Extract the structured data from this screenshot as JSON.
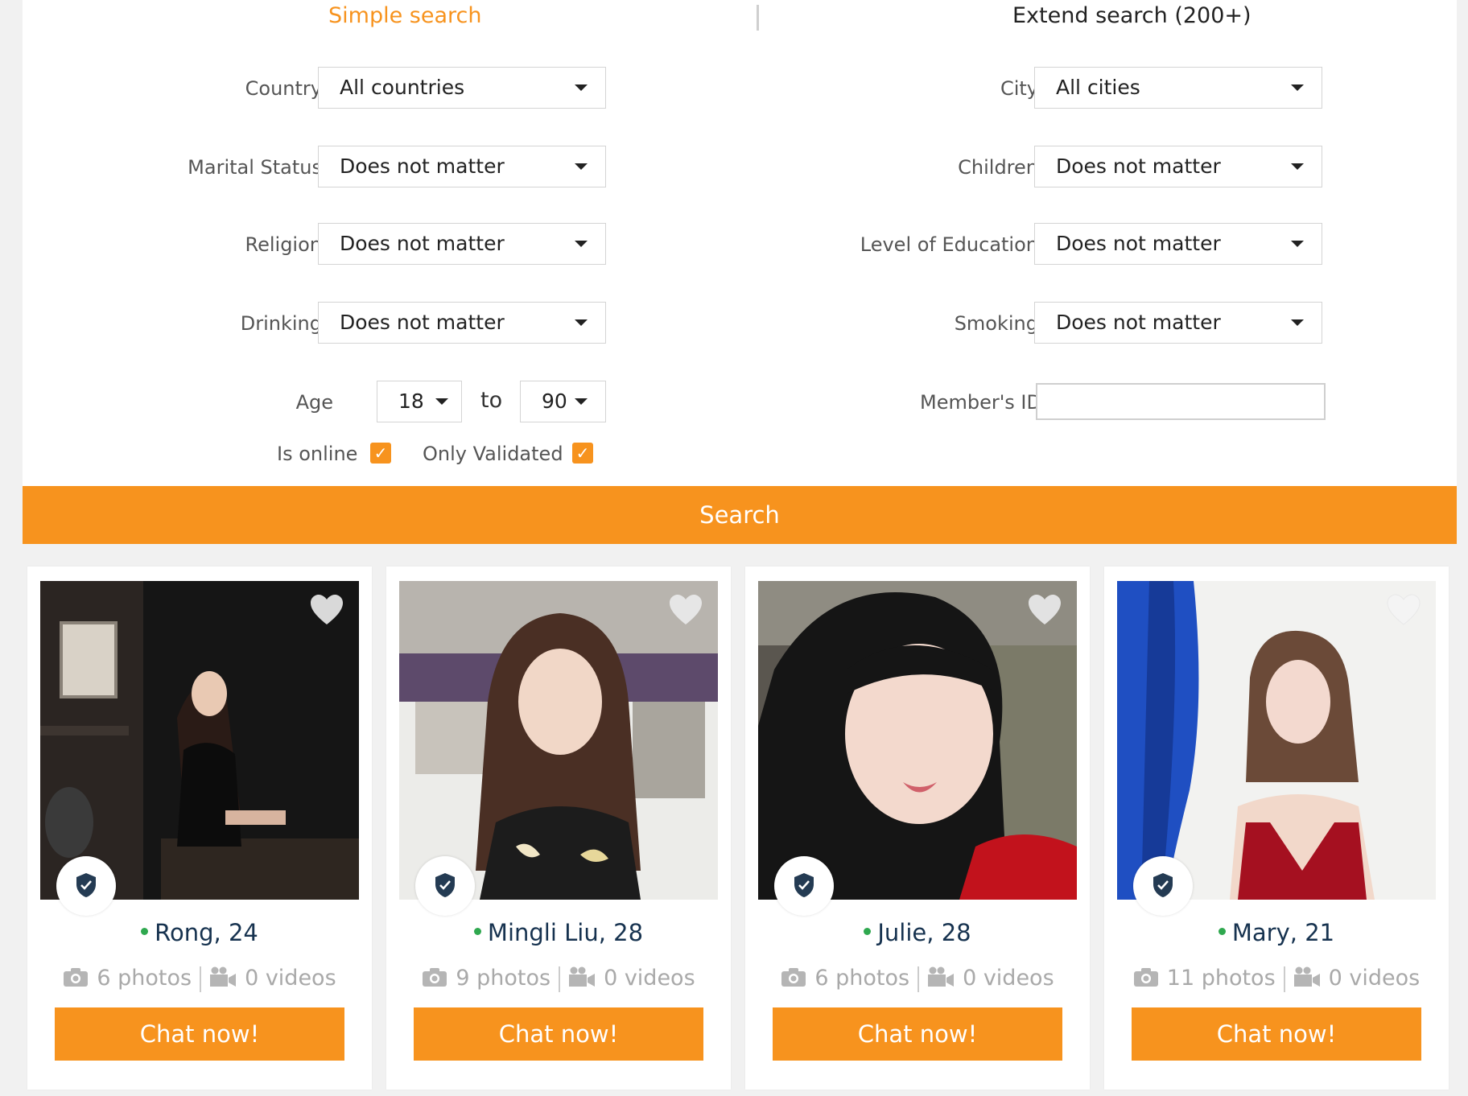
{
  "tabs": {
    "simple": "Simple search",
    "extend": "Extend search (200+)"
  },
  "left_fields": [
    {
      "label": "Country",
      "value": "All countries"
    },
    {
      "label": "Marital Status",
      "value": "Does not matter"
    },
    {
      "label": "Religion",
      "value": "Does not matter"
    },
    {
      "label": "Drinking",
      "value": "Does not matter"
    }
  ],
  "right_fields": [
    {
      "label": "City",
      "value": "All cities"
    },
    {
      "label": "Children",
      "value": "Does not matter"
    },
    {
      "label": "Level of Education",
      "value": "Does not matter"
    },
    {
      "label": "Smoking",
      "value": "Does not matter"
    }
  ],
  "age": {
    "label": "Age",
    "from": "18",
    "to_text": "to",
    "to": "90"
  },
  "member_id": {
    "label": "Member's ID",
    "value": ""
  },
  "checks": {
    "online": "Is online",
    "validated": "Only Validated"
  },
  "search_button": "Search",
  "accent_color": "#f7931e",
  "profiles": [
    {
      "name": "Rong, 24",
      "photos": "6 photos",
      "videos": "0 videos",
      "chat": "Chat now!"
    },
    {
      "name": "Mingli Liu, 28",
      "photos": "9 photos",
      "videos": "0 videos",
      "chat": "Chat now!"
    },
    {
      "name": "Julie, 28",
      "photos": "6 photos",
      "videos": "0 videos",
      "chat": "Chat now!"
    },
    {
      "name": "Mary, 21",
      "photos": "11 photos",
      "videos": "0 videos",
      "chat": "Chat now!"
    }
  ]
}
